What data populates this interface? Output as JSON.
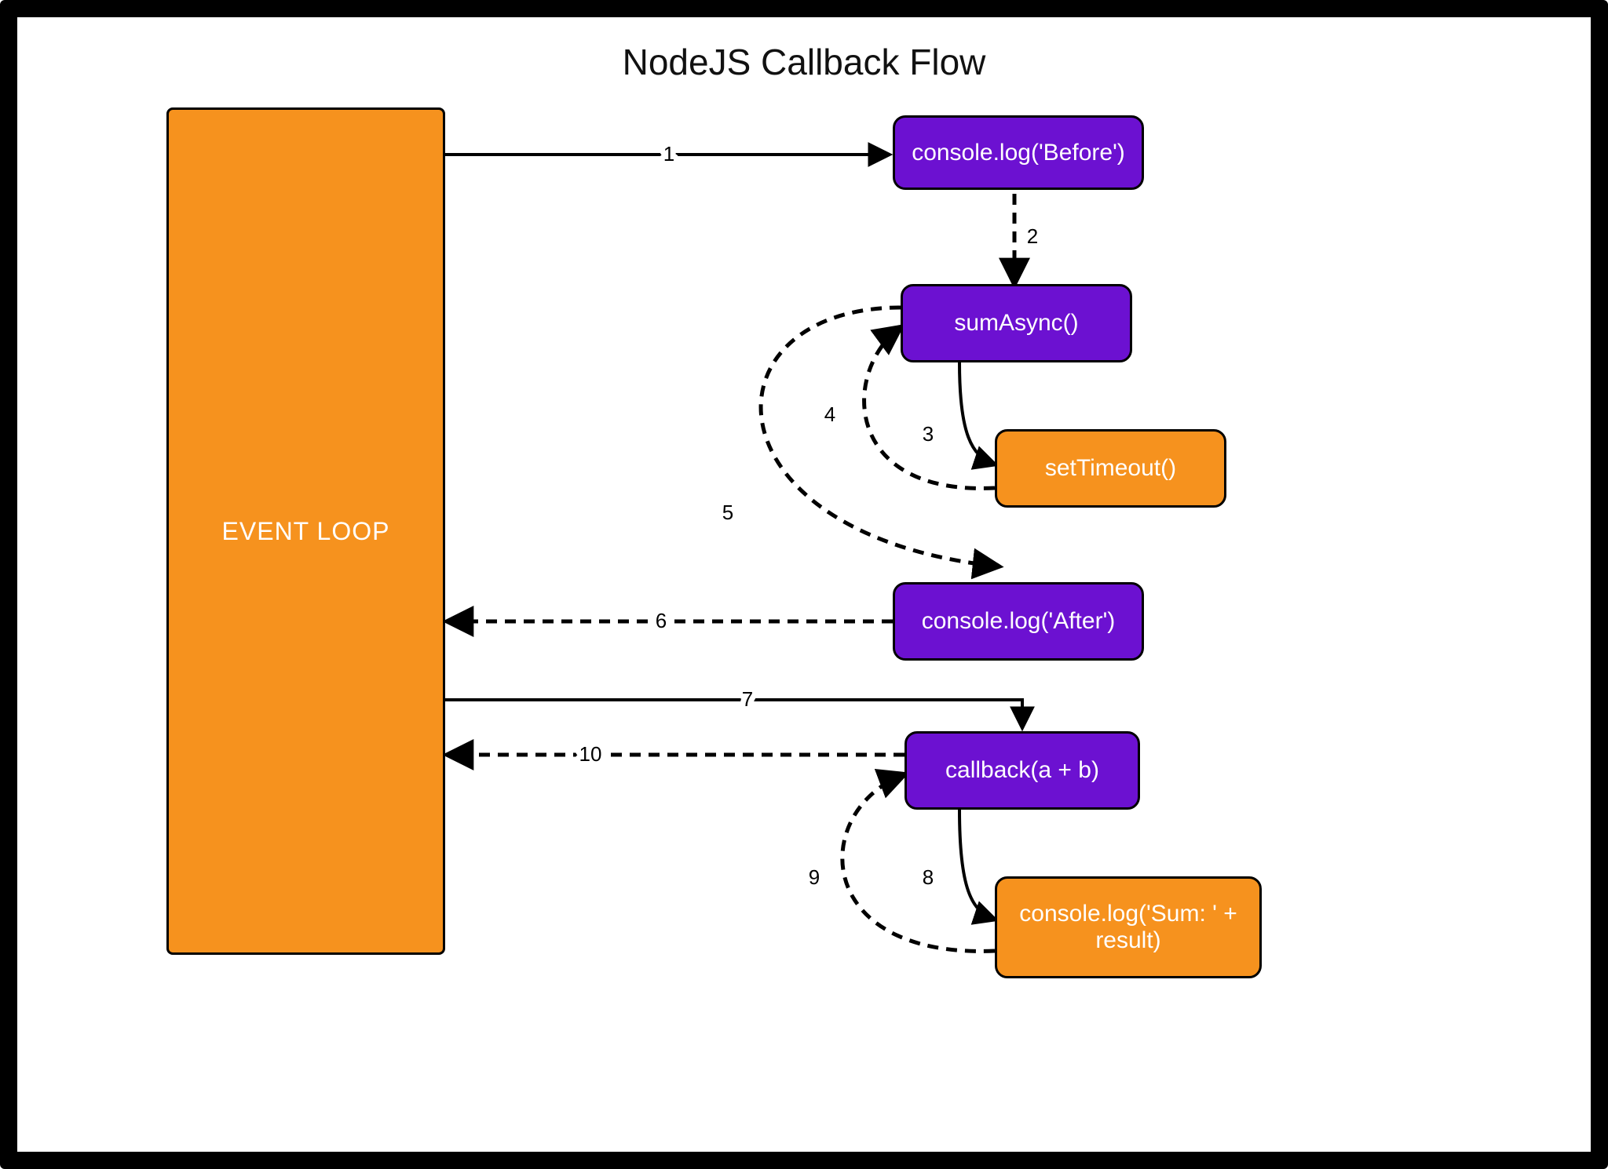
{
  "title": "NodeJS Callback Flow",
  "nodes": {
    "eventloop": "EVENT LOOP",
    "before": "console.log('Before')",
    "sumasync": "sumAsync()",
    "settimeout": "setTimeout()",
    "after": "console.log('After')",
    "callback": "callback(a + b)",
    "logsum": "console.log('Sum: ' + result)"
  },
  "edges": {
    "e1": "1",
    "e2": "2",
    "e3": "3",
    "e4": "4",
    "e5": "5",
    "e6": "6",
    "e7": "7",
    "e8": "8",
    "e9": "9",
    "e10": "10"
  }
}
